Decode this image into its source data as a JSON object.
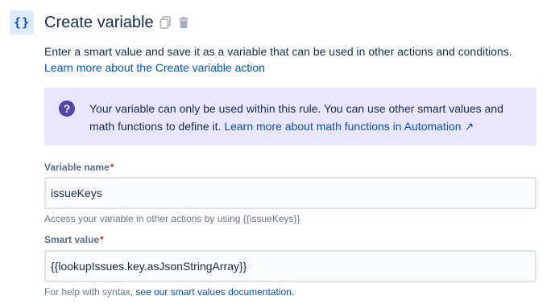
{
  "header": {
    "icon_glyph": "{}",
    "title": "Create variable",
    "copy_icon": "copy-icon",
    "delete_icon": "trash-icon"
  },
  "description": {
    "text": "Enter a smart value and save it as a variable that can be used in other actions and conditions.",
    "link": "Learn more about the Create variable action"
  },
  "info_panel": {
    "icon": "question-icon",
    "text": "Your variable can only be used within this rule. You can use other smart values and math functions to define it.",
    "link": "Learn more about math functions in Automation ↗"
  },
  "variable_name": {
    "label": "Variable name",
    "required_mark": "*",
    "value": "issueKeys",
    "help": "Access your variable in other actions by using {{issueKeys}}"
  },
  "smart_value": {
    "label": "Smart value",
    "required_mark": "*",
    "value": "{{lookupIssues.key.asJsonStringArray}}",
    "help_prefix": "For help with syntax,",
    "help_link": "see our smart values documentation."
  },
  "colors": {
    "accent": "#0052CC",
    "info_bg": "#EAE6FF",
    "info_icon": "#5243AA",
    "required": "#DE350B"
  }
}
